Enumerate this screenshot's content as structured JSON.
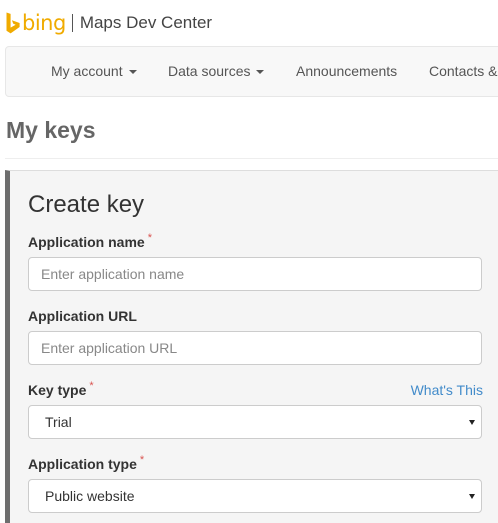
{
  "brand": {
    "logo_text": "bing",
    "site_title": "Maps Dev Center",
    "accent_color": "#f0ab00"
  },
  "nav": {
    "items": [
      {
        "label": "My account",
        "dropdown": true
      },
      {
        "label": "Data sources",
        "dropdown": true
      },
      {
        "label": "Announcements",
        "dropdown": false
      },
      {
        "label": "Contacts &",
        "dropdown": false
      }
    ]
  },
  "page": {
    "heading": "My keys"
  },
  "form": {
    "title": "Create key",
    "required_marker": "*",
    "app_name": {
      "label": "Application name",
      "placeholder": "Enter application name"
    },
    "app_url": {
      "label": "Application URL",
      "placeholder": "Enter application URL"
    },
    "key_type": {
      "label": "Key type",
      "help_link": "What's This",
      "selected": "Trial"
    },
    "app_type": {
      "label": "Application type",
      "selected": "Public website"
    }
  },
  "icons": {
    "logo": "bing-logo-icon",
    "dropdown": "caret-down-icon",
    "select": "select-arrow-icon"
  }
}
